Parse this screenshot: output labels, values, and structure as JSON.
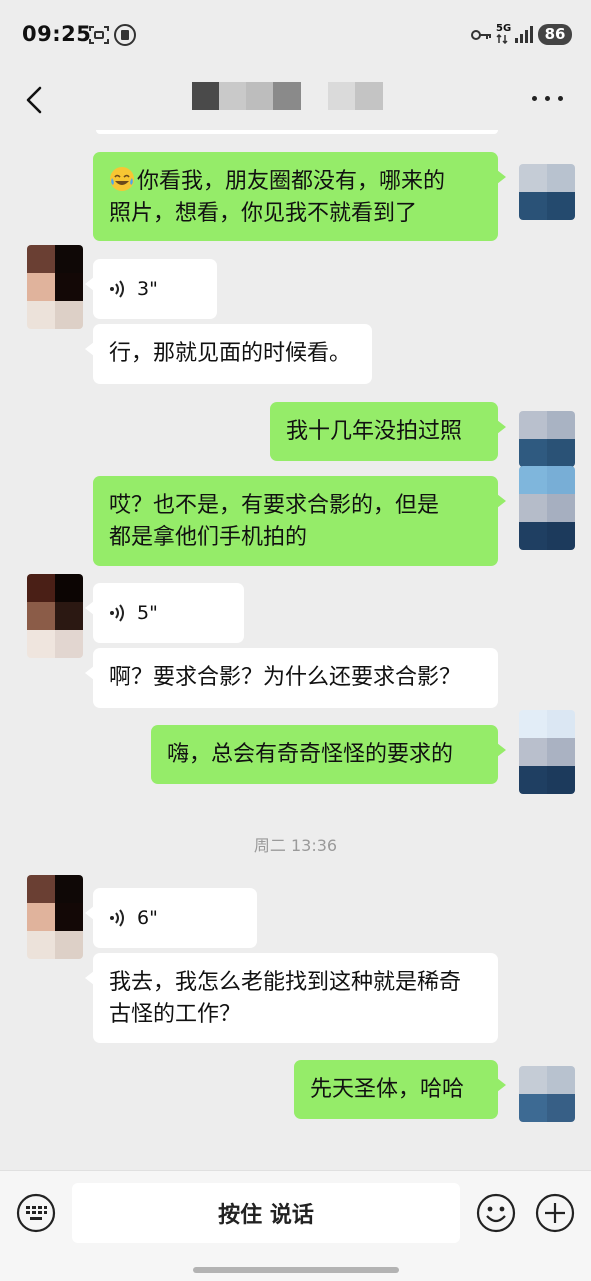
{
  "status_bar": {
    "time": "09:25",
    "network": "5G",
    "battery": "86"
  },
  "header": {
    "back_icon": "chevron-left-icon",
    "more_icon": "more-dots-icon"
  },
  "messages": [
    {
      "side": "me",
      "type": "text",
      "emoji": "laughing-tears-emoji",
      "lines": [
        "你看我，朋友圈都没有，哪来的",
        "照片，想看，你见我不就看到了"
      ]
    },
    {
      "side": "them",
      "type": "voice",
      "duration": "3\""
    },
    {
      "side": "them",
      "type": "text",
      "lines": [
        "行，那就见面的时候看。"
      ]
    },
    {
      "side": "me",
      "type": "text",
      "lines": [
        "我十几年没拍过照"
      ]
    },
    {
      "side": "me",
      "type": "text",
      "lines": [
        "哎？也不是，有要求合影的，但是",
        "都是拿他们手机拍的"
      ]
    },
    {
      "side": "them",
      "type": "voice",
      "duration": "5\""
    },
    {
      "side": "them",
      "type": "text",
      "lines": [
        "啊？要求合影？为什么还要求合影？"
      ]
    },
    {
      "side": "me",
      "type": "text",
      "lines": [
        "嗨，总会有奇奇怪怪的要求的"
      ]
    },
    {
      "side": "system",
      "type": "timestamp",
      "text": "周二 13:36"
    },
    {
      "side": "them",
      "type": "voice",
      "duration": "6\""
    },
    {
      "side": "them",
      "type": "text",
      "lines": [
        "我去，我怎么老能找到这种就是稀奇",
        "古怪的工作？"
      ]
    },
    {
      "side": "me",
      "type": "text",
      "lines": [
        "先天圣体，哈哈"
      ]
    }
  ],
  "input_bar": {
    "keyboard_icon": "keyboard-icon",
    "hold_to_talk": "按住 说话",
    "emoji_icon": "smiley-icon",
    "plus_icon": "plus-circle-icon"
  },
  "colors": {
    "background": "#ededed",
    "my_bubble": "#95ec69",
    "their_bubble": "#ffffff"
  }
}
